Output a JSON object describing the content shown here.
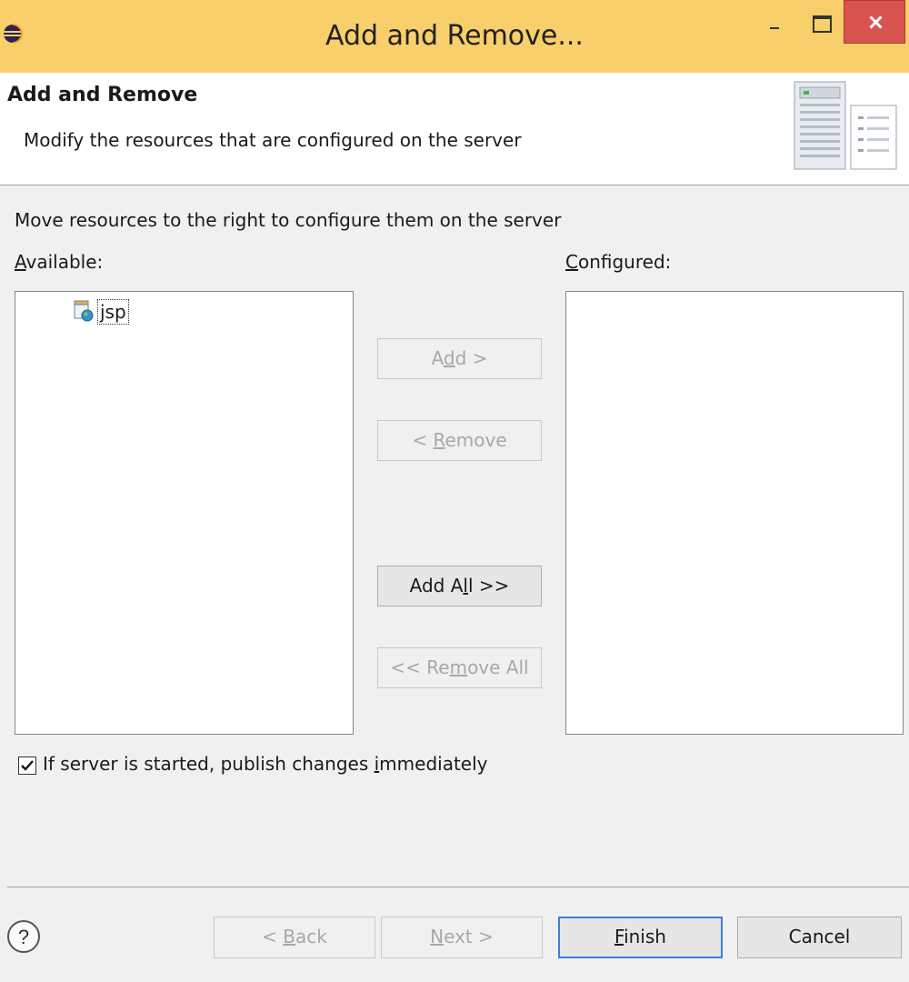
{
  "window": {
    "title": "Add and Remove...",
    "icons": {
      "app": "eclipse-icon",
      "minimize": "minimize-icon",
      "maximize": "maximize-icon",
      "close": "close-icon"
    },
    "close_color": "#d9534f",
    "titlebar_color": "#f8cf6a"
  },
  "banner": {
    "title": "Add and Remove",
    "description": "Modify the resources that are configured on the server",
    "icon": "server-icon"
  },
  "instruction": "Move resources to the right to configure them on the server",
  "available": {
    "label_mnemonic": "A",
    "label_rest": "vailable:",
    "items": [
      {
        "label": "jsp",
        "icon": "web-project-icon"
      }
    ]
  },
  "configured": {
    "label_mnemonic": "C",
    "label_rest": "onfigured:",
    "items": []
  },
  "buttons": {
    "add": {
      "pre": "A",
      "mn": "d",
      "post": "d >",
      "enabled": false
    },
    "remove": {
      "pre": "< ",
      "mn": "R",
      "post": "emove",
      "enabled": false
    },
    "add_all": {
      "pre": "Add A",
      "mn": "l",
      "post": "l >>",
      "enabled": true
    },
    "remove_all": {
      "pre": "<< Re",
      "mn": "m",
      "post": "ove All",
      "enabled": false
    }
  },
  "publish_option": {
    "checked": true,
    "pre": "If server is started, publish changes ",
    "mn": "i",
    "post": "mmediately"
  },
  "footer": {
    "help_icon": "help-icon",
    "back": {
      "pre": "< ",
      "mn": "B",
      "post": "ack",
      "enabled": false
    },
    "next": {
      "pre": "",
      "mn": "N",
      "post": "ext >",
      "enabled": false
    },
    "finish": {
      "pre": "",
      "mn": "F",
      "post": "inish",
      "enabled": true
    },
    "cancel": {
      "label": "Cancel",
      "enabled": true
    }
  }
}
